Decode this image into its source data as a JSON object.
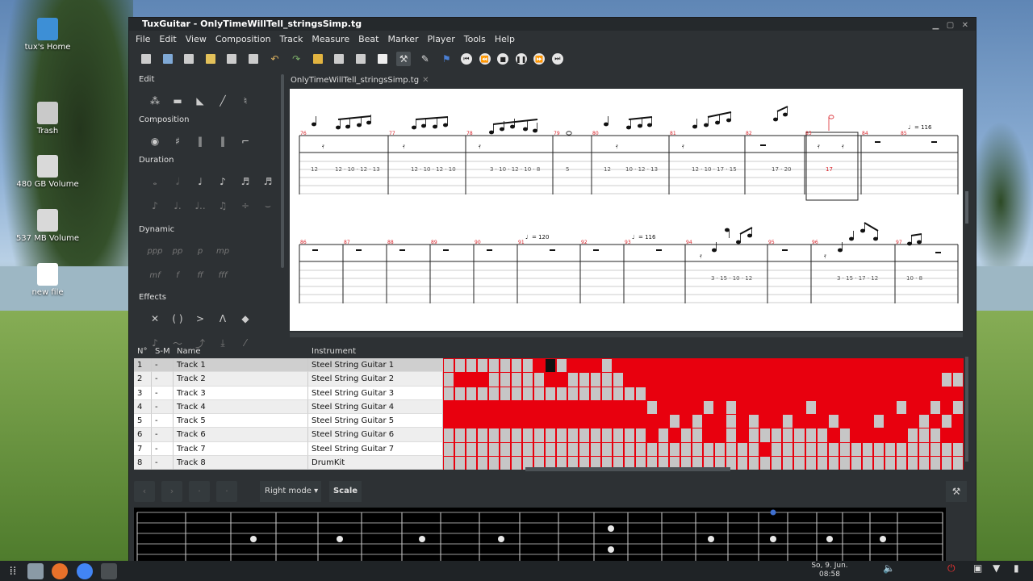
{
  "desktop": {
    "icons": [
      {
        "label": "tux's Home"
      },
      {
        "label": "Trash"
      },
      {
        "label": "480 GB Volume"
      },
      {
        "label": "537 MB Volume"
      },
      {
        "label": "new file"
      }
    ]
  },
  "window": {
    "title": "TuxGuitar - OnlyTimeWillTell_stringsSimp.tg",
    "menu": [
      "File",
      "Edit",
      "View",
      "Composition",
      "Track",
      "Measure",
      "Beat",
      "Marker",
      "Player",
      "Tools",
      "Help"
    ],
    "doc_tab": "OnlyTimeWillTell_stringsSimp.tg"
  },
  "side": {
    "edit": "Edit",
    "composition": "Composition",
    "duration": "Duration",
    "dynamic": "Dynamic",
    "effects": "Effects",
    "dynamics_marks": [
      "ppp",
      "pp",
      "p",
      "mp",
      "mf",
      "f",
      "ff",
      "fff"
    ]
  },
  "score": {
    "system1": {
      "measures": [
        "76",
        "77",
        "78",
        "79",
        "80",
        "81",
        "82",
        "83",
        "84",
        "85"
      ],
      "frets": [
        "12",
        "12 · 10 · 12 · 13",
        "12 · 10 · 12 · 10",
        "3 · 10 · 12 · 10 · 8",
        "5",
        "12",
        "10 · 12 · 13",
        "12 · 10 · 17 · 15",
        "17 · 20",
        "17"
      ],
      "tempo": "= 116"
    },
    "system2": {
      "measures": [
        "86",
        "87",
        "88",
        "89",
        "90",
        "91",
        "92",
        "93",
        "94",
        "95",
        "96",
        "97"
      ],
      "frets": [
        "3 · 15 · 10 · 12",
        "3 · 15 · 17 · 12",
        "10 · 8"
      ],
      "tempo_a": "= 120",
      "tempo_b": "= 116"
    }
  },
  "tracks": {
    "headers": {
      "no": "N°",
      "sm": "S-M",
      "name": "Name",
      "instrument": "Instrument"
    },
    "rows": [
      {
        "no": "1",
        "sm": "-",
        "name": "Track 1",
        "instrument": "Steel String Guitar 1"
      },
      {
        "no": "2",
        "sm": "-",
        "name": "Track 2",
        "instrument": "Steel String Guitar 2"
      },
      {
        "no": "3",
        "sm": "-",
        "name": "Track 3",
        "instrument": "Steel String Guitar 3"
      },
      {
        "no": "4",
        "sm": "-",
        "name": "Track 4",
        "instrument": "Steel String Guitar 4"
      },
      {
        "no": "5",
        "sm": "-",
        "name": "Track 5",
        "instrument": "Steel String Guitar 5"
      },
      {
        "no": "6",
        "sm": "-",
        "name": "Track 6",
        "instrument": "Steel String Guitar 6"
      },
      {
        "no": "7",
        "sm": "-",
        "name": "Track 7",
        "instrument": "Steel String Guitar 7"
      },
      {
        "no": "8",
        "sm": "-",
        "name": "Track 8",
        "instrument": "DrumKit"
      }
    ]
  },
  "bottom": {
    "mode": "Right mode",
    "scale": "Scale"
  },
  "taskbar": {
    "day": "So, 9. Jun.",
    "time": "08:58"
  },
  "colors": {
    "measure_grid": "#e8000e",
    "grid_filled": "#c6c6c6",
    "measure_number": "#d9242b",
    "score_bg": "#ffffff"
  }
}
